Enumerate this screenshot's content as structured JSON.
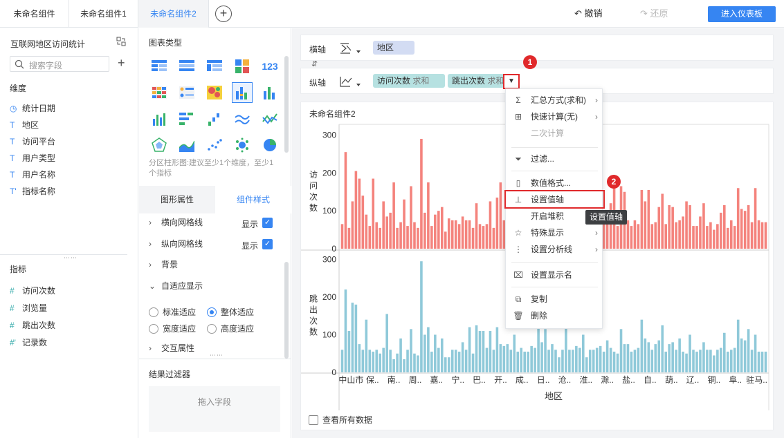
{
  "tabs": [
    "未命名组件",
    "未命名组件1",
    "未命名组件2"
  ],
  "toolbar": {
    "undo": "撤销",
    "redo": "还原",
    "enter": "进入仪表板"
  },
  "left": {
    "dataset": "互联网地区访问统计",
    "search_placeholder": "搜索字段",
    "dim_label": "维度",
    "dims": [
      "统计日期",
      "地区",
      "访问平台",
      "用户类型",
      "用户名称",
      "指标名称"
    ],
    "metric_label": "指标",
    "metrics": [
      "访问次数",
      "浏览量",
      "跳出次数",
      "记录数"
    ]
  },
  "middle": {
    "chart_type_title": "图表类型",
    "hint": "分区柱形图:建议至少1个维度，至少1个指标",
    "tab_shape": "图形属性",
    "tab_style": "组件样式",
    "props": [
      "横向网格线",
      "纵向网格线",
      "背景",
      "自适应显示",
      "交互属性"
    ],
    "show": "显示",
    "radios": [
      "标准适应",
      "整体适应",
      "宽度适应",
      "高度适应"
    ],
    "result_filter": "结果过滤器",
    "drop_hint": "拖入字段"
  },
  "axes": {
    "x_label": "横轴",
    "y_label": "纵轴",
    "x_field": "地区",
    "y_fields": [
      {
        "name": "访问次数",
        "agg": "求和"
      },
      {
        "name": "跳出次数",
        "agg": "求和"
      }
    ]
  },
  "chart_title": "未命名组件2",
  "show_all": "查看所有数据",
  "menu": {
    "items": [
      "汇总方式(求和)",
      "快速计算(无)",
      "二次计算",
      "过滤...",
      "数值格式...",
      "设置值轴",
      "开启堆积",
      "特殊显示",
      "设置分析线",
      "设置显示名",
      "复制",
      "删除"
    ],
    "tooltip": "设置值轴",
    "badge1": "1",
    "badge2": "2"
  },
  "chart_data": {
    "type": "bar",
    "xlabel": "地区",
    "x_tick_labels": [
      "中山市",
      "保..",
      "南..",
      "周..",
      "嘉..",
      "宁..",
      "巴..",
      "开..",
      "成..",
      "日..",
      "沧..",
      "淮..",
      "滁..",
      "盐..",
      "自..",
      "葫..",
      "辽..",
      "铜..",
      "阜..",
      "驻马.."
    ],
    "colors": {
      "visits": "#f4837d",
      "bounces": "#8fc9d9"
    },
    "panels": [
      {
        "ylabel": "访问次数",
        "yticks": [
          0,
          100,
          200,
          300
        ],
        "ylim": [
          0,
          310
        ],
        "values": [
          65,
          255,
          55,
          125,
          205,
          185,
          140,
          90,
          60,
          185,
          70,
          55,
          125,
          85,
          95,
          175,
          55,
          70,
          130,
          60,
          165,
          70,
          55,
          290,
          95,
          175,
          60,
          90,
          100,
          110,
          45,
          80,
          75,
          75,
          65,
          85,
          75,
          75,
          55,
          120,
          65,
          60,
          65,
          125,
          55,
          135,
          175,
          75,
          160,
          65,
          70,
          80,
          85,
          105,
          75,
          45,
          95,
          180,
          170,
          130,
          75,
          135,
          110,
          100,
          65,
          170,
          65,
          105,
          75,
          85,
          120,
          60,
          140,
          75,
          100,
          85,
          100,
          80,
          120,
          160,
          60,
          165,
          150,
          75,
          60,
          75,
          65,
          155,
          125,
          155,
          65,
          70,
          110,
          145,
          65,
          115,
          110,
          70,
          75,
          85,
          125,
          115,
          60,
          60,
          85,
          120,
          60,
          70,
          50,
          65,
          95,
          115,
          55,
          75,
          60,
          160,
          105,
          100,
          115,
          70,
          160,
          75,
          70,
          70
        ]
      },
      {
        "ylabel": "跳出次数",
        "yticks": [
          0,
          100,
          200,
          300
        ],
        "ylim": [
          0,
          310
        ],
        "values": [
          60,
          220,
          110,
          185,
          180,
          75,
          60,
          140,
          60,
          55,
          60,
          50,
          65,
          155,
          60,
          35,
          50,
          90,
          35,
          60,
          115,
          50,
          45,
          295,
          100,
          120,
          55,
          100,
          65,
          90,
          40,
          40,
          60,
          60,
          55,
          80,
          60,
          120,
          50,
          125,
          110,
          110,
          65,
          110,
          60,
          120,
          75,
          70,
          75,
          60,
          100,
          55,
          65,
          55,
          55,
          70,
          65,
          130,
          80,
          115,
          60,
          75,
          60,
          40,
          60,
          125,
          60,
          60,
          70,
          65,
          100,
          40,
          60,
          60,
          65,
          70,
          55,
          85,
          65,
          55,
          50,
          115,
          75,
          75,
          55,
          60,
          65,
          140,
          90,
          80,
          60,
          75,
          85,
          125,
          55,
          75,
          80,
          60,
          90,
          55,
          50,
          100,
          60,
          55,
          60,
          80,
          60,
          60,
          45,
          60,
          65,
          105,
          55,
          60,
          65,
          140,
          90,
          85,
          115,
          60,
          100,
          55,
          55,
          55
        ]
      }
    ]
  }
}
